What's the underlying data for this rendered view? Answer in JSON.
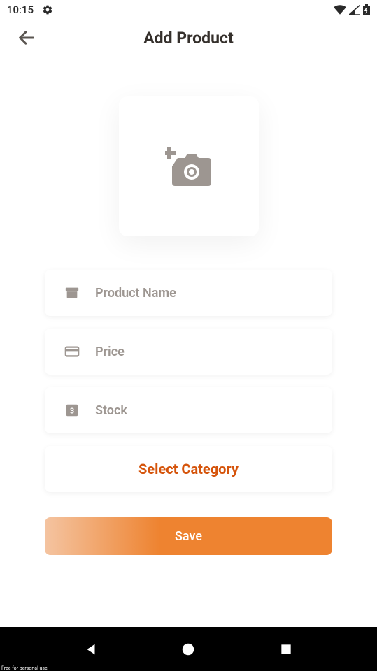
{
  "status": {
    "time": "10:15"
  },
  "header": {
    "title": "Add Product"
  },
  "fields": {
    "productName": {
      "placeholder": "Product Name",
      "value": ""
    },
    "price": {
      "placeholder": "Price",
      "value": ""
    },
    "stock": {
      "placeholder": "Stock",
      "value": ""
    }
  },
  "buttons": {
    "category": "Select Category",
    "save": "Save"
  },
  "footer": {
    "freeText": "Free for personal use"
  },
  "colors": {
    "accent": "#d5540b",
    "saveGradientStart": "#f4c4a1",
    "saveGradientEnd": "#ee8330",
    "placeholder": "#9d9691",
    "iconGray": "#9d9691"
  }
}
